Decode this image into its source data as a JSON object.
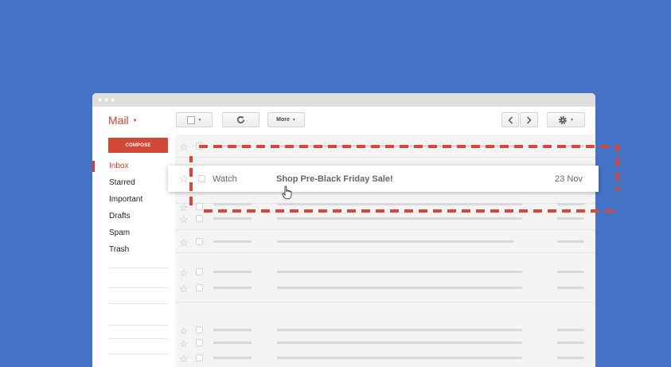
{
  "app": {
    "logo": "Mail",
    "compose_label": "COMPOSE"
  },
  "toolbar": {
    "more_label": "More"
  },
  "sidebar": {
    "items": [
      {
        "label": "Inbox",
        "active": true
      },
      {
        "label": "Starred"
      },
      {
        "label": "Important"
      },
      {
        "label": "Drafts"
      },
      {
        "label": "Spam"
      },
      {
        "label": "Trash"
      }
    ]
  },
  "highlighted_email": {
    "sender": "Watch",
    "subject": "Shop Pre-Black Friday Sale!",
    "date": "23 Nov"
  },
  "colors": {
    "background": "#4472c4",
    "accent": "#d23f31",
    "dash_border": "#d9473b"
  }
}
